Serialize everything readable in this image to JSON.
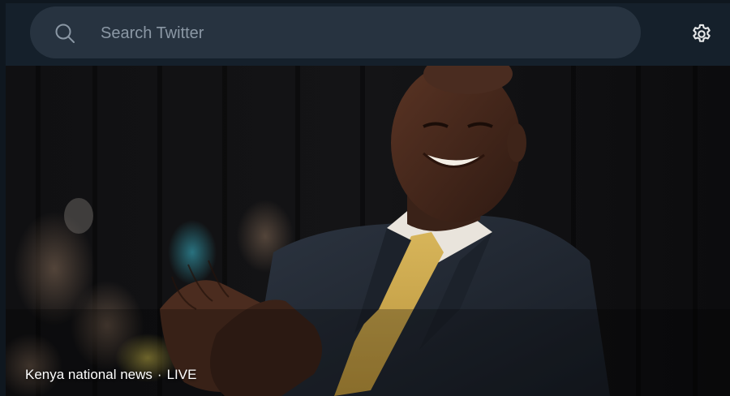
{
  "search": {
    "placeholder": "Search Twitter"
  },
  "icons": {
    "search": "search-icon",
    "settings": "gear-icon"
  },
  "hero": {
    "topic": "Kenya national news",
    "separator": "·",
    "status": "LIVE"
  },
  "colors": {
    "background": "#15202b",
    "search_box": "#273340",
    "placeholder_text": "#8b98a5",
    "icon": "#e7e9ea"
  }
}
